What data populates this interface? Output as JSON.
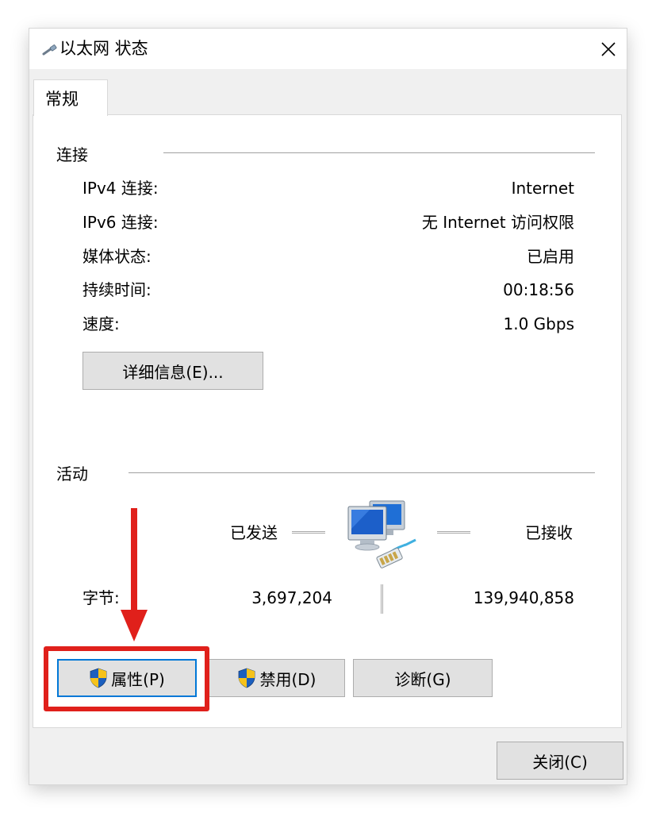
{
  "window": {
    "title": "以太网 状态",
    "close_glyph": "✕"
  },
  "tabs": [
    {
      "label": "常规"
    }
  ],
  "connection": {
    "heading": "连接",
    "rows": [
      {
        "label": "IPv4 连接:",
        "value": "Internet"
      },
      {
        "label": "IPv6 连接:",
        "value": "无 Internet 访问权限"
      },
      {
        "label": "媒体状态:",
        "value": "已启用"
      },
      {
        "label": "持续时间:",
        "value": "00:18:56"
      },
      {
        "label": "速度:",
        "value": "1.0 Gbps"
      }
    ],
    "details_button": "详细信息(E)..."
  },
  "activity": {
    "heading": "活动",
    "sent_label": "已发送",
    "received_label": "已接收",
    "bytes_label": "字节:",
    "bytes_sent": "3,697,204",
    "bytes_received": "139,940,858",
    "icon": "network-computers-icon"
  },
  "actions": {
    "properties_button": "属性(P)",
    "disable_button": "禁用(D)",
    "diagnose_button": "诊断(G)"
  },
  "footer": {
    "close_button": "关闭(C)"
  },
  "annotation": {
    "highlight_color": "#e0201b",
    "target": "properties-button"
  },
  "colors": {
    "focus_border": "#0078d7",
    "button_face": "#e1e1e1",
    "dialog_bg": "#f0f0f0"
  }
}
